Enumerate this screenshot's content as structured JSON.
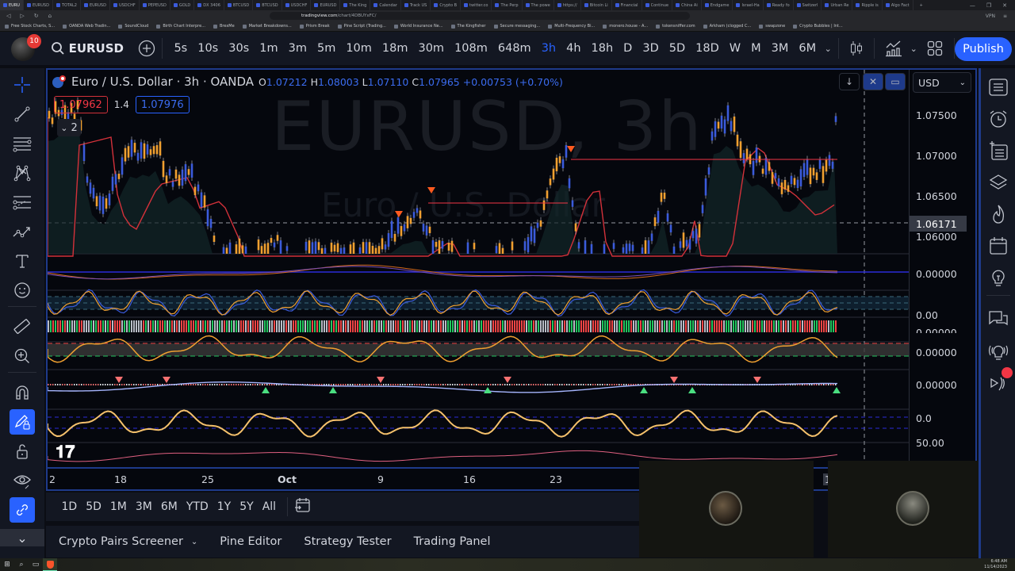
{
  "browser": {
    "tabs": [
      {
        "label": "EURU",
        "active": true
      },
      {
        "label": "EURUSD"
      },
      {
        "label": "TOTAL2"
      },
      {
        "label": "EURUSD"
      },
      {
        "label": "USDCHF"
      },
      {
        "label": "PEPEUSD"
      },
      {
        "label": "GOLD"
      },
      {
        "label": "DX 3406"
      },
      {
        "label": "BTCUSD"
      },
      {
        "label": "BTCUSD"
      },
      {
        "label": "USDCHF"
      },
      {
        "label": "EURUSD"
      },
      {
        "label": "The King"
      },
      {
        "label": "Calendar"
      },
      {
        "label": "Track US"
      },
      {
        "label": "Crypto B"
      },
      {
        "label": "twitter.co"
      },
      {
        "label": "The Perp"
      },
      {
        "label": "The powe"
      },
      {
        "label": "https://"
      },
      {
        "label": "Bitcoin Li"
      },
      {
        "label": "Financial"
      },
      {
        "label": "Continue"
      },
      {
        "label": "China Ai"
      },
      {
        "label": "Endgame"
      },
      {
        "label": "Israel-Ha"
      },
      {
        "label": "Ready fo"
      },
      {
        "label": "Switzerl"
      },
      {
        "label": "Urban Re"
      },
      {
        "label": "Ripple is"
      },
      {
        "label": "Algo Fact"
      }
    ],
    "new_tab": "+",
    "url_host": "tradingview.com",
    "url_path": "/chart/4DBUYxFC/",
    "vpn_label": "VPN",
    "bookmarks": [
      "Free Stock Charts, S...",
      "OANDA Web Tradin...",
      "SoundCloud",
      "Birth Chart Interpre...",
      "BrexMe",
      "Market Breakdowns...",
      "Prism Break",
      "Pine Script (Trading...",
      "World Insurance Ne...",
      "The Kingfisher",
      "Secure messaging...",
      "Multi-Frequency Bi...",
      "monero.house - A...",
      "tokensniffer.com",
      "Arkham (clogged C...",
      "swapzone",
      "Crypto Bubbles | Int..."
    ]
  },
  "header": {
    "notification_count": "10",
    "symbol": "EURUSD",
    "intervals": [
      "5s",
      "10s",
      "30s",
      "1m",
      "3m",
      "5m",
      "10m",
      "18m",
      "30m",
      "108m",
      "648m",
      "3h",
      "4h",
      "18h",
      "D",
      "3D",
      "5D",
      "18D",
      "W",
      "M",
      "3M",
      "6M"
    ],
    "active_interval": "3h",
    "publish_label": "Publish"
  },
  "legend": {
    "title": "Euro / U.S. Dollar · 3h · OANDA",
    "o_label": "O",
    "o": "1.07212",
    "h_label": "H",
    "h": "1.08003",
    "l_label": "L",
    "l": "1.07110",
    "c_label": "C",
    "c": "1.07965",
    "change": "+0.00753 (+0.70%)",
    "sell_price": "1.07962",
    "spread": "1.4",
    "buy_price": "1.07976",
    "indicators_collapsed": "2"
  },
  "watermark": {
    "line1": "EURUSD, 3h",
    "line2": "Euro / U.S. Dollar"
  },
  "currency": "USD",
  "price_scale": {
    "labels": [
      "1.07500",
      "1.07000",
      "1.06500",
      "1.06000"
    ],
    "crosshair": "1.06171",
    "pane_labels": [
      "0.00000",
      "0.00",
      "0.00000",
      "0.00000",
      "0.00000",
      "0.0",
      "50.00"
    ]
  },
  "time_axis": {
    "labels": [
      "2",
      "18",
      "25",
      "Oct",
      "9",
      "16",
      "23",
      "1"
    ]
  },
  "range_bar": {
    "ranges": [
      "1D",
      "5D",
      "1M",
      "3M",
      "6M",
      "YTD",
      "1Y",
      "5Y",
      "All"
    ]
  },
  "bottom_tabs": {
    "screener": "Crypto Pairs Screener",
    "pine": "Pine Editor",
    "strategy": "Strategy Tester",
    "trading": "Trading Panel"
  },
  "taskbar": {
    "time": "6:48 AM",
    "date": "11/14/2023"
  },
  "colors": {
    "accent": "#2962ff",
    "bull": "#3b5bdb",
    "bear": "#f0a030",
    "signal_red": "#f23645",
    "signal_green": "#22c55e"
  }
}
